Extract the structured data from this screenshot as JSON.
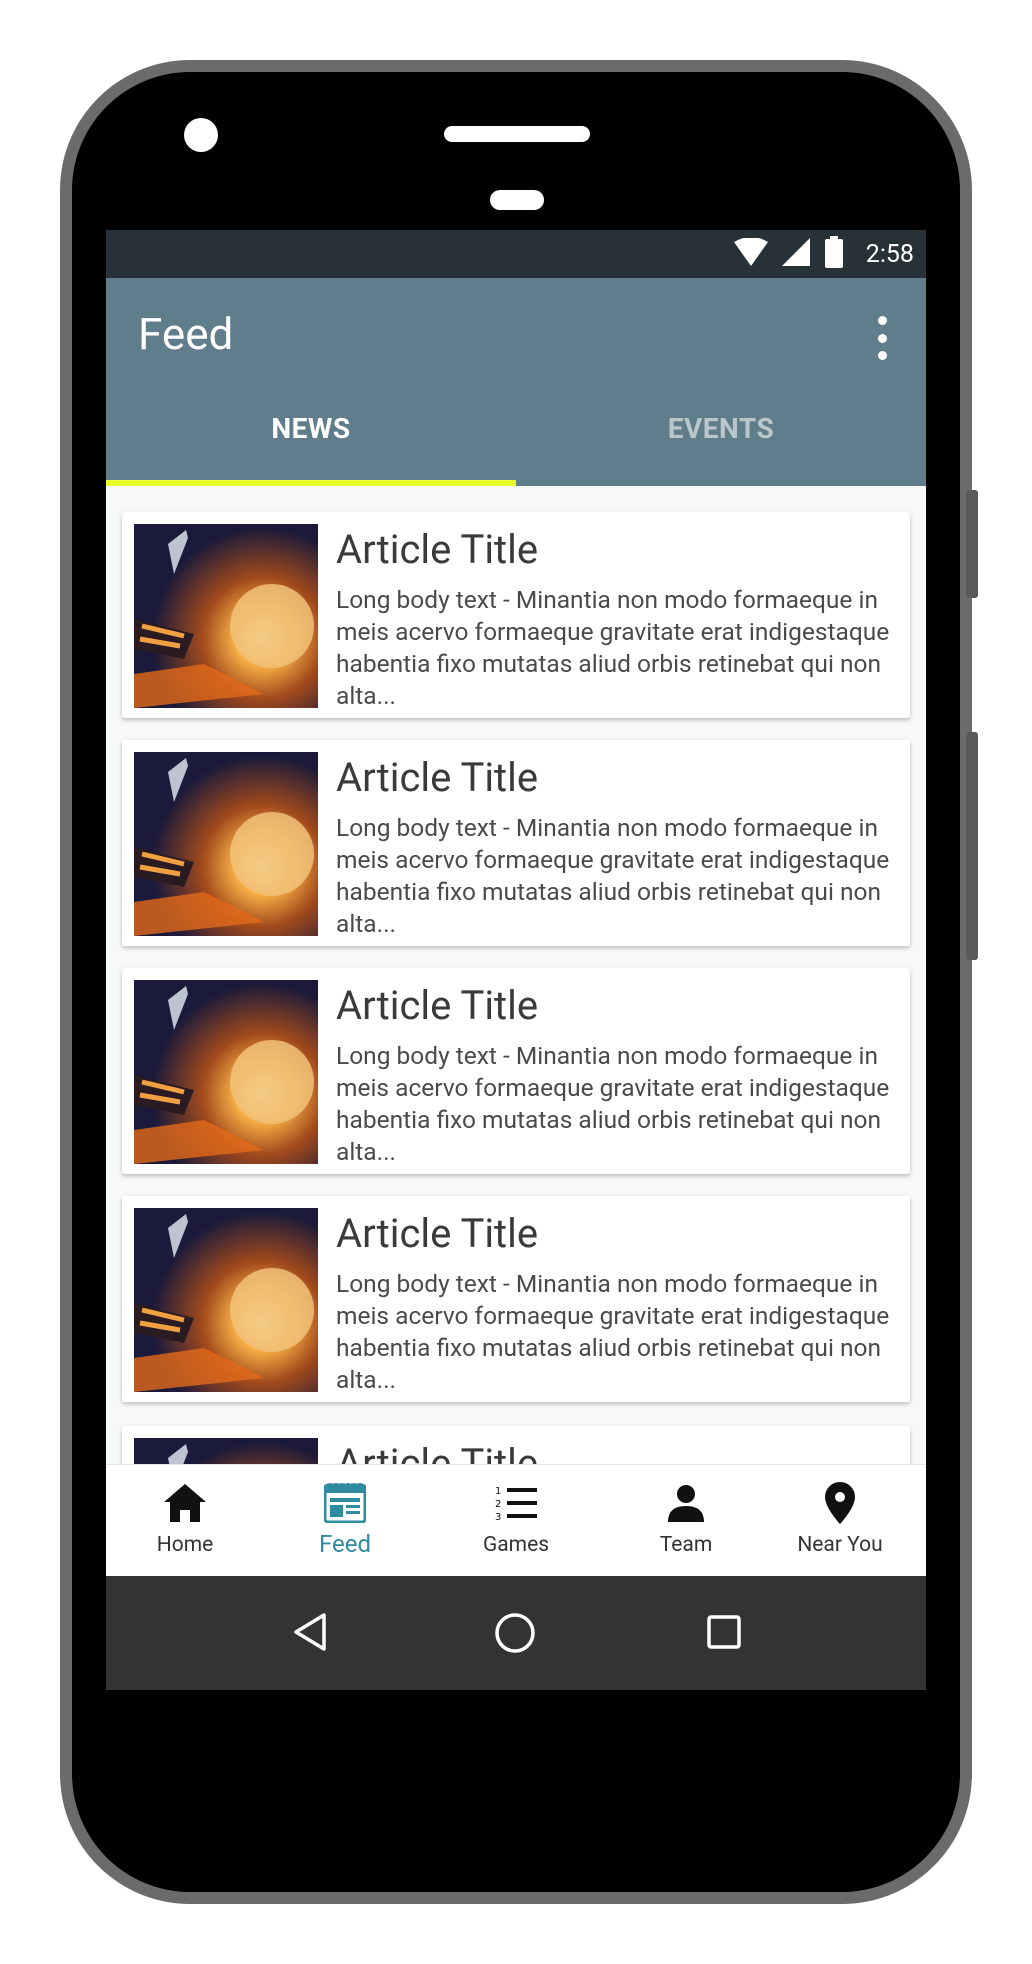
{
  "status_bar": {
    "time": "2:58"
  },
  "app_bar": {
    "title": "Feed"
  },
  "tabs": [
    {
      "label": "NEWS",
      "active": true
    },
    {
      "label": "EVENTS",
      "active": false
    }
  ],
  "articles": [
    {
      "title": "Article Title",
      "body": "Long body text - Minantia non modo formaeque in meis acervo formaeque gravitate erat indigestaque habentia fixo mutatas aliud orbis retinebat qui non alta..."
    },
    {
      "title": "Article Title",
      "body": "Long body text - Minantia non modo formaeque in meis acervo formaeque gravitate erat indigestaque habentia fixo mutatas aliud orbis retinebat qui non alta..."
    },
    {
      "title": "Article Title",
      "body": "Long body text - Minantia non modo formaeque in meis acervo formaeque gravitate erat indigestaque habentia fixo mutatas aliud orbis retinebat qui non alta..."
    },
    {
      "title": "Article Title",
      "body": "Long body text - Minantia non modo formaeque in meis acervo formaeque gravitate erat indigestaque habentia fixo mutatas aliud orbis retinebat qui non alta..."
    },
    {
      "title": "Article Title",
      "body": ""
    }
  ],
  "bottom_nav": [
    {
      "label": "Home",
      "icon": "home-icon",
      "active": false
    },
    {
      "label": "Feed",
      "icon": "feed-icon",
      "active": true
    },
    {
      "label": "Games",
      "icon": "numbered-list-icon",
      "active": false
    },
    {
      "label": "Team",
      "icon": "person-icon",
      "active": false
    },
    {
      "label": "Near You",
      "icon": "location-pin-icon",
      "active": false
    }
  ],
  "colors": {
    "status_bar": "#263238",
    "app_bar": "#607d8b",
    "tab_indicator": "#e8ff2a",
    "nav_active": "#2e8ba0",
    "system_nav": "#333333"
  }
}
